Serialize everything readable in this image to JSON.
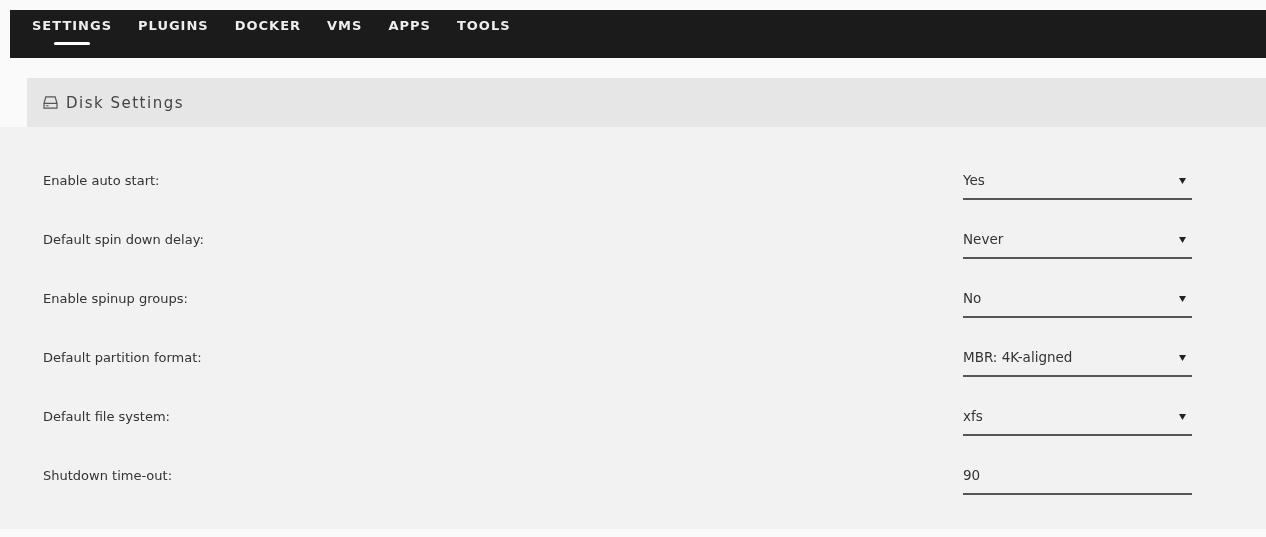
{
  "nav": {
    "tabs": [
      {
        "label": "SETTINGS",
        "selected": true
      },
      {
        "label": "PLUGINS",
        "selected": false
      },
      {
        "label": "DOCKER",
        "selected": false
      },
      {
        "label": "VMS",
        "selected": false
      },
      {
        "label": "APPS",
        "selected": false
      },
      {
        "label": "TOOLS",
        "selected": false
      }
    ]
  },
  "panel": {
    "title": "Disk Settings"
  },
  "settings": [
    {
      "label": "Enable auto start:",
      "kind": "select",
      "value": "Yes"
    },
    {
      "label": "Default spin down delay:",
      "kind": "select",
      "value": "Never"
    },
    {
      "label": "Enable spinup groups:",
      "kind": "select",
      "value": "No"
    },
    {
      "label": "Default partition format:",
      "kind": "select",
      "value": "MBR: 4K-aligned"
    },
    {
      "label": "Default file system:",
      "kind": "select",
      "value": "xfs"
    },
    {
      "label": "Shutdown time-out:",
      "kind": "input",
      "value": "90"
    }
  ]
}
